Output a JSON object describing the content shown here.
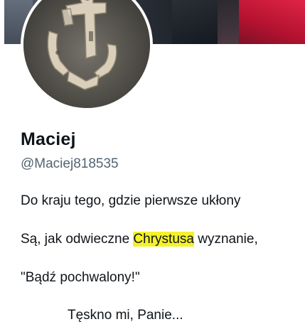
{
  "profile": {
    "name": "Maciej",
    "handle": "@Maciej818535",
    "avatar_icon": "anchor-sculpture-icon"
  },
  "bio": {
    "line1": "Do kraju tego, gdzie pierwsze ukłony",
    "line2_before": "Są, jak odwieczne ",
    "line2_highlight": "Chrystusa",
    "line2_after": " wyznanie,",
    "line3": "\"Bądź pochwalony!\"",
    "line4": "Tęskno mi, Panie..."
  },
  "colors": {
    "highlight": "#f5f22a",
    "muted_text": "#536471",
    "text": "#0f1419"
  }
}
